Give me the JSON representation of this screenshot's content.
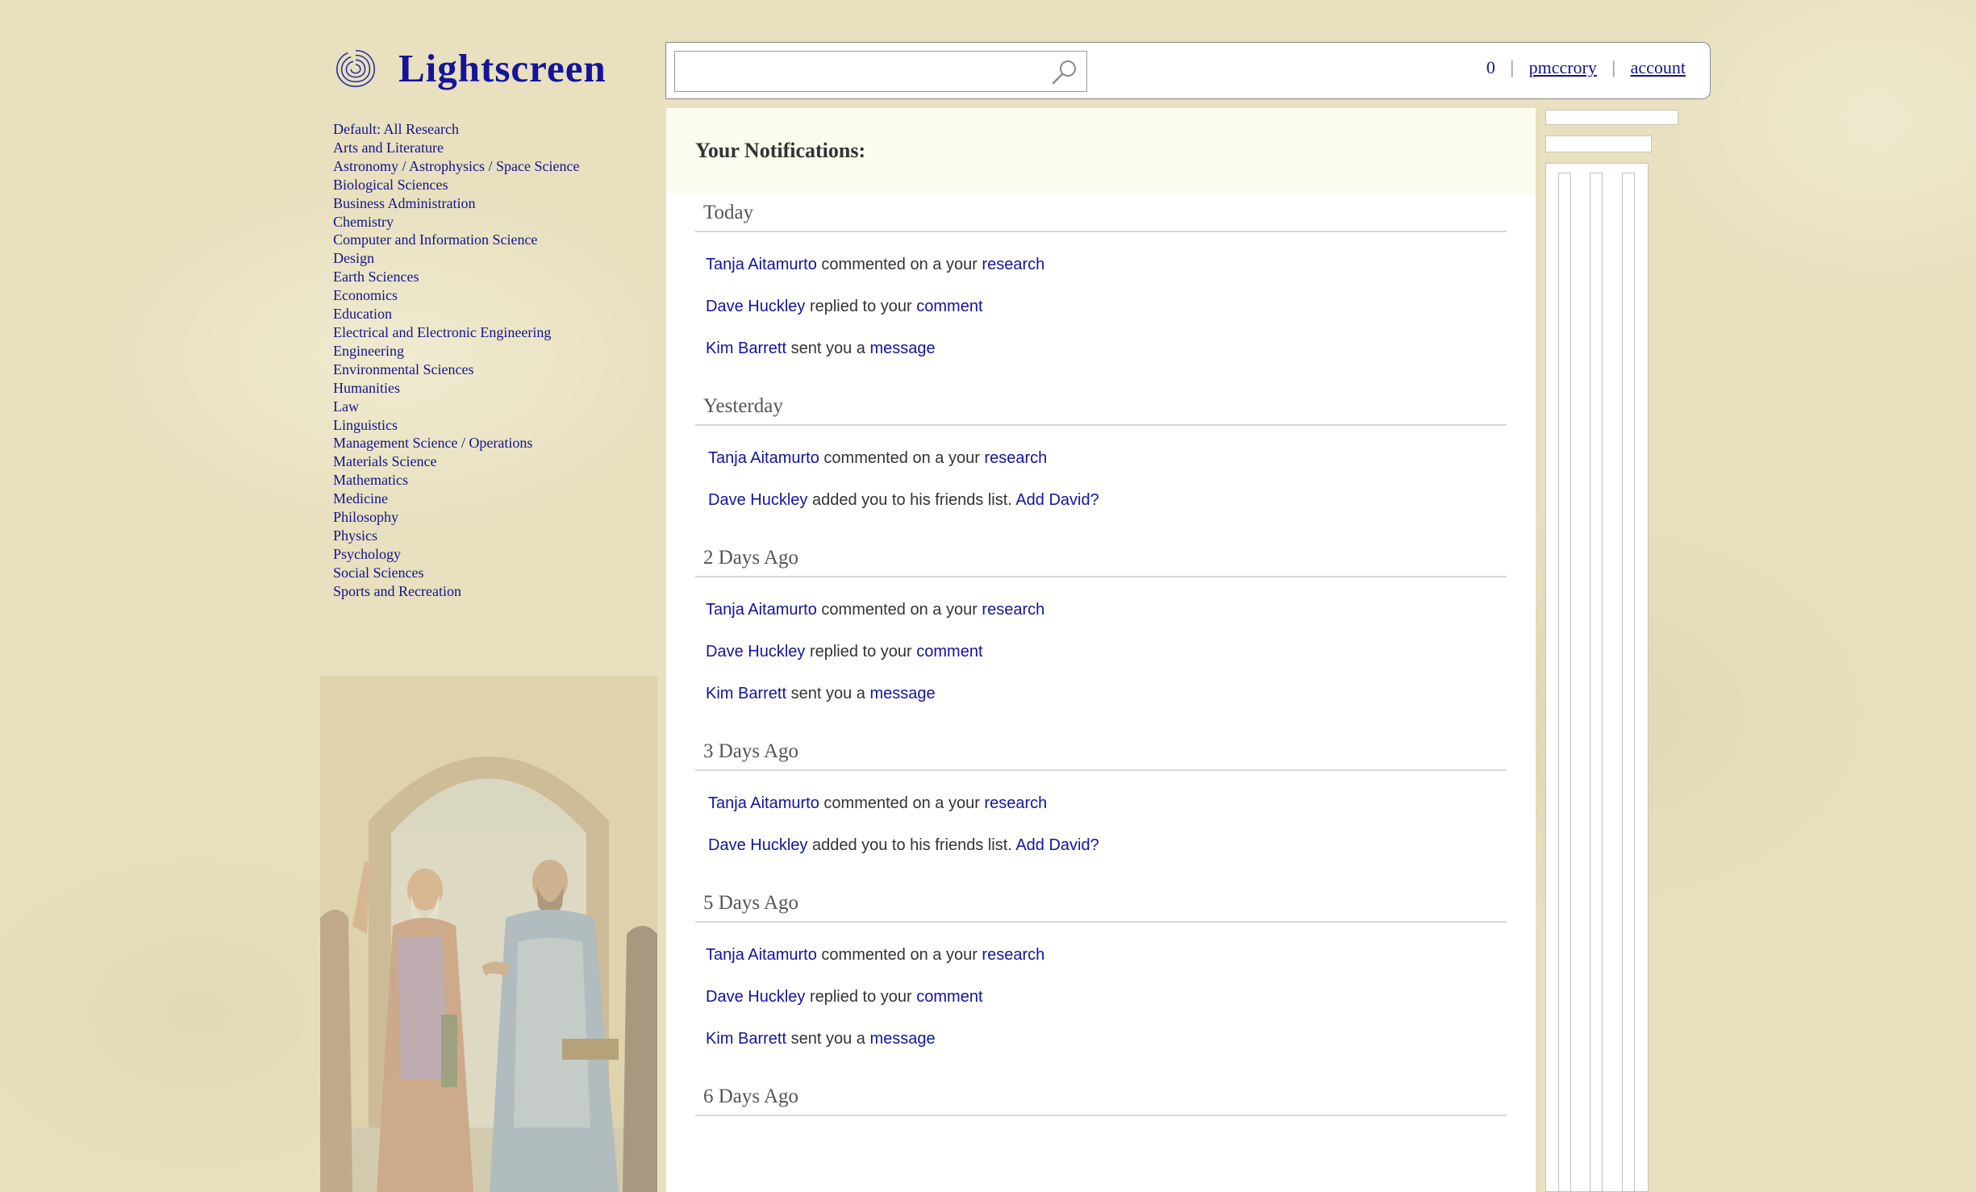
{
  "app": {
    "name": "Lightscreen"
  },
  "categories": [
    "Default: All Research",
    "Arts and Literature",
    "Astronomy / Astrophysics / Space Science",
    "Biological Sciences",
    "Business Administration",
    "Chemistry",
    "Computer and Information Science",
    "Design",
    "Earth Sciences",
    "Economics",
    "Education",
    "Electrical and Electronic Engineering",
    "Engineering",
    "Environmental Sciences",
    "Humanities",
    "Law",
    "Linguistics",
    "Management Science / Operations",
    "Materials Science",
    "Mathematics",
    "Medicine",
    "Philosophy",
    "Physics",
    "Psychology",
    "Social Sciences",
    "Sports and Recreation"
  ],
  "search": {
    "value": "",
    "placeholder": ""
  },
  "user_nav": {
    "count": "0",
    "username": "pmccrory",
    "account": "account"
  },
  "main": {
    "title": "Your Notifications:",
    "days": [
      {
        "label": "Today",
        "items": [
          {
            "actor": "Tanja Aitamurto",
            "text": " commented on a your ",
            "link": "research"
          },
          {
            "actor": "Dave Huckley",
            "text": " replied to your ",
            "link": "comment"
          },
          {
            "actor": "Kim Barrett",
            "text": " sent you a ",
            "link": "message"
          }
        ]
      },
      {
        "label": "Yesterday",
        "items": [
          {
            "actor": "Tanja Aitamurto",
            "text": " commented on a your ",
            "link": "research"
          },
          {
            "actor": "Dave Huckley",
            "text": " added you to his friends list. ",
            "link": "Add David?"
          }
        ]
      },
      {
        "label": "2 Days Ago",
        "items": [
          {
            "actor": "Tanja Aitamurto",
            "text": " commented on a your ",
            "link": "research"
          },
          {
            "actor": "Dave Huckley",
            "text": " replied to your ",
            "link": "comment"
          },
          {
            "actor": "Kim Barrett",
            "text": " sent you a ",
            "link": "message"
          }
        ]
      },
      {
        "label": "3 Days Ago",
        "items": [
          {
            "actor": "Tanja Aitamurto",
            "text": " commented on a your ",
            "link": "research"
          },
          {
            "actor": "Dave Huckley",
            "text": " added you to his friends list. ",
            "link": "Add David?"
          }
        ]
      },
      {
        "label": "5 Days Ago",
        "items": [
          {
            "actor": "Tanja Aitamurto",
            "text": " commented on a your ",
            "link": "research"
          },
          {
            "actor": "Dave Huckley",
            "text": " replied to your ",
            "link": "comment"
          },
          {
            "actor": "Kim Barrett",
            "text": " sent you a ",
            "link": "message"
          }
        ]
      },
      {
        "label": "6 Days Ago",
        "items": []
      }
    ]
  },
  "colors": {
    "background": "#e8e0bf",
    "link": "#14149b",
    "logo": "#14149b"
  }
}
